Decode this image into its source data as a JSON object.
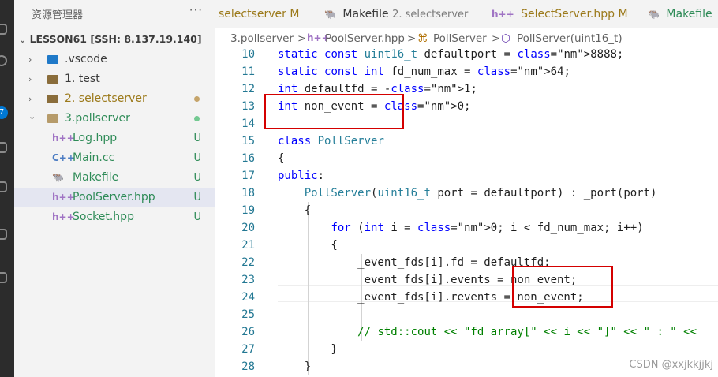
{
  "sidebar": {
    "title": "资源管理器",
    "more": "···",
    "root": "LESSON61 [SSH: 8.137.19.140]",
    "items": [
      {
        "label": ".vscode",
        "type": "folder",
        "status": "",
        "chevron": "›"
      },
      {
        "label": "1. test",
        "type": "folder",
        "status": "",
        "chevron": "›"
      },
      {
        "label": "2. selectserver",
        "type": "folder",
        "status": "dot",
        "chevron": "›"
      },
      {
        "label": "3.pollserver",
        "type": "folder-open",
        "status": "dot",
        "chevron": "⌄"
      },
      {
        "label": "Log.hpp",
        "type": "hpp",
        "icon": "h++",
        "status": "U"
      },
      {
        "label": "Main.cc",
        "type": "cc",
        "icon": "C++",
        "status": "U"
      },
      {
        "label": "Makefile",
        "type": "makefile",
        "icon": "🐃",
        "status": "U"
      },
      {
        "label": "PoolServer.hpp",
        "type": "hpp",
        "icon": "h++",
        "status": "U"
      },
      {
        "label": "Socket.hpp",
        "type": "hpp",
        "icon": "h++",
        "status": "U"
      }
    ]
  },
  "tabs": [
    {
      "label": "selectserver",
      "mod": "M",
      "hint": "",
      "icon": ""
    },
    {
      "label": "Makefile",
      "mod": "",
      "hint": "2. selectserver",
      "icon": "🐃"
    },
    {
      "label": "SelectServer.hpp",
      "mod": "M",
      "hint": "",
      "icon": "h++"
    },
    {
      "label": "Makefile",
      "mod": "",
      "hint": "",
      "icon": "🐃"
    }
  ],
  "breadcrumb": [
    "3.pollserver",
    ">",
    "h++",
    "PoolServer.hpp",
    ">",
    "PollServer",
    ">",
    "PollServer(uint16_t)"
  ],
  "editor": {
    "line_numbers": [
      "10",
      "11",
      "12",
      "13",
      "14",
      "15",
      "16",
      "17",
      "18",
      "19",
      "20",
      "21",
      "22",
      "23",
      "24",
      "25",
      "26",
      "27",
      "28"
    ],
    "lines": [
      "static const uint16_t defaultport = 8888;",
      "static const int fd_num_max = 64;",
      "int defaultfd = -1;",
      "int non_event = 0;",
      "",
      "class PollServer",
      "{",
      "public:",
      "    PollServer(uint16_t port = defaultport) : _port(port)",
      "    {",
      "        for (int i = 0; i < fd_num_max; i++)",
      "        {",
      "            _event_fds[i].fd = defaultfd;",
      "            _event_fds[i].events = non_event;",
      "            _event_fds[i].revents = non_event;",
      "",
      "            // std::cout << \"fd_array[\" << i << \"]\" << \" : \" <<",
      "        }",
      "    }"
    ]
  },
  "watermark": "CSDN @xxjkkjjkj",
  "colors": {
    "accent": "#0078d4",
    "highlight_box": "#d40000",
    "git_untracked": "#2e8b57",
    "git_modified": "#b38600"
  }
}
